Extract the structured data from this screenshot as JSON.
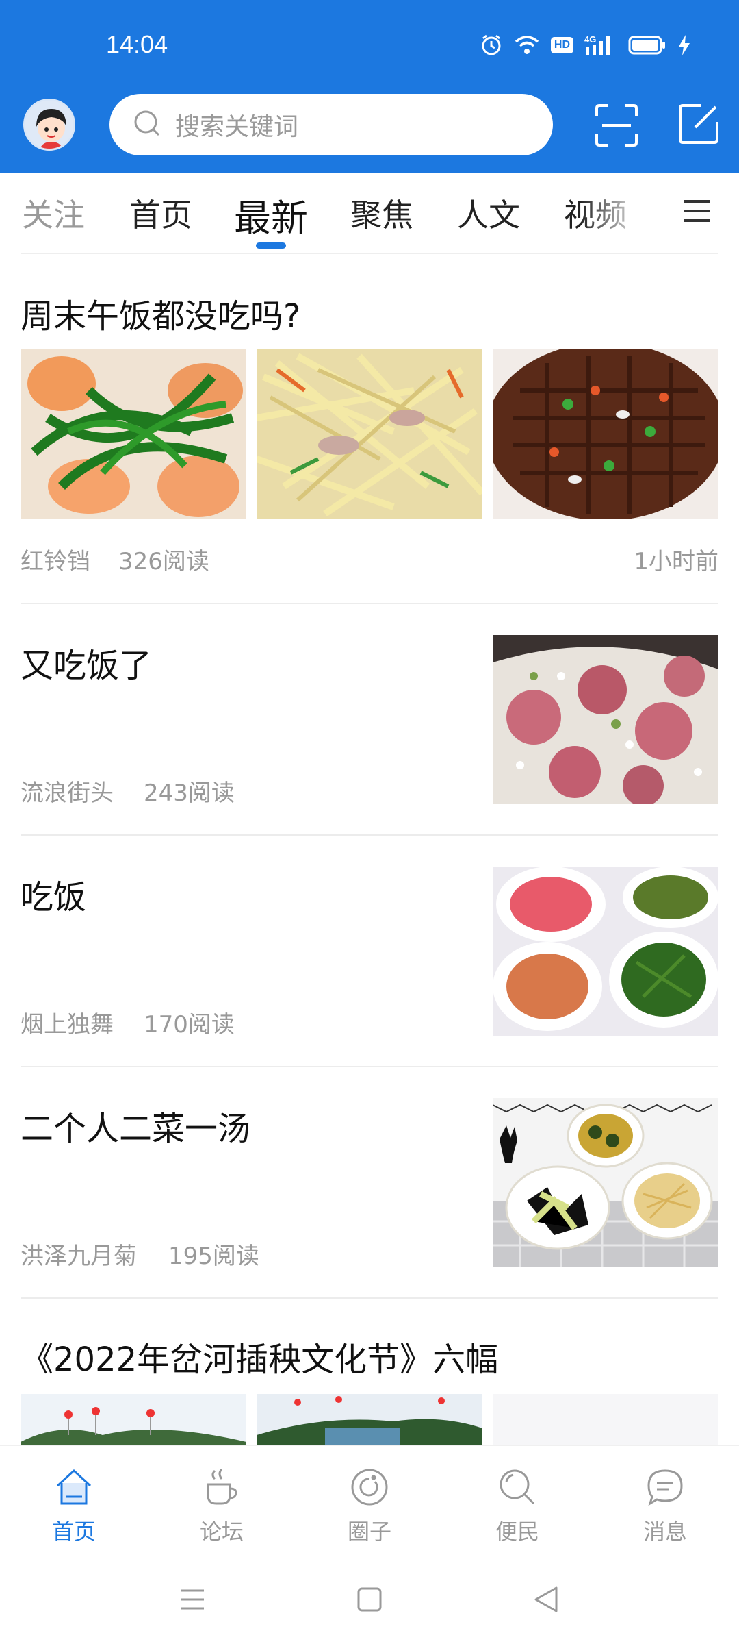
{
  "status_bar": {
    "time": "14:04",
    "icons": [
      "alarm-icon",
      "wifi-icon",
      "hd-icon",
      "4g-signal-icon",
      "battery-icon",
      "charging-icon"
    ],
    "hd_label": "HD",
    "network_label": "4G"
  },
  "header": {
    "avatar": "avatar",
    "search_placeholder": "搜索关键词",
    "icons": [
      "search-icon",
      "scan-icon",
      "edit-icon"
    ]
  },
  "tabs": {
    "items": [
      {
        "label": "关注"
      },
      {
        "label": "首页"
      },
      {
        "label": "最新"
      },
      {
        "label": "聚焦"
      },
      {
        "label": "人文"
      },
      {
        "label": "视频"
      }
    ],
    "active_index": 2,
    "menu_icon": "menu-icon"
  },
  "feed": {
    "items": [
      {
        "title": "周末午饭都没吃吗?",
        "author": "红铃铛",
        "reads": "326阅读",
        "time": "1小时前",
        "layout": "three-images"
      },
      {
        "title": "又吃饭了",
        "author": "流浪街头",
        "reads": "243阅读",
        "layout": "right-image"
      },
      {
        "title": "吃饭",
        "author": "烟上独舞",
        "reads": "170阅读",
        "layout": "right-image"
      },
      {
        "title": "二个人二菜一汤",
        "author": "洪泽九月菊",
        "reads": "195阅读",
        "layout": "right-image"
      },
      {
        "title": "《2022年岔河插秧文化节》六幅",
        "layout": "three-images"
      }
    ]
  },
  "bottom_nav": {
    "items": [
      {
        "label": "首页",
        "icon": "home-icon"
      },
      {
        "label": "论坛",
        "icon": "coffee-cup-icon"
      },
      {
        "label": "圈子",
        "icon": "circle-icon"
      },
      {
        "label": "便民",
        "icon": "search-icon"
      },
      {
        "label": "消息",
        "icon": "message-icon"
      }
    ],
    "active_index": 0
  },
  "colors": {
    "brand_blue": "#1c78e0",
    "meta_gray": "#999999"
  }
}
